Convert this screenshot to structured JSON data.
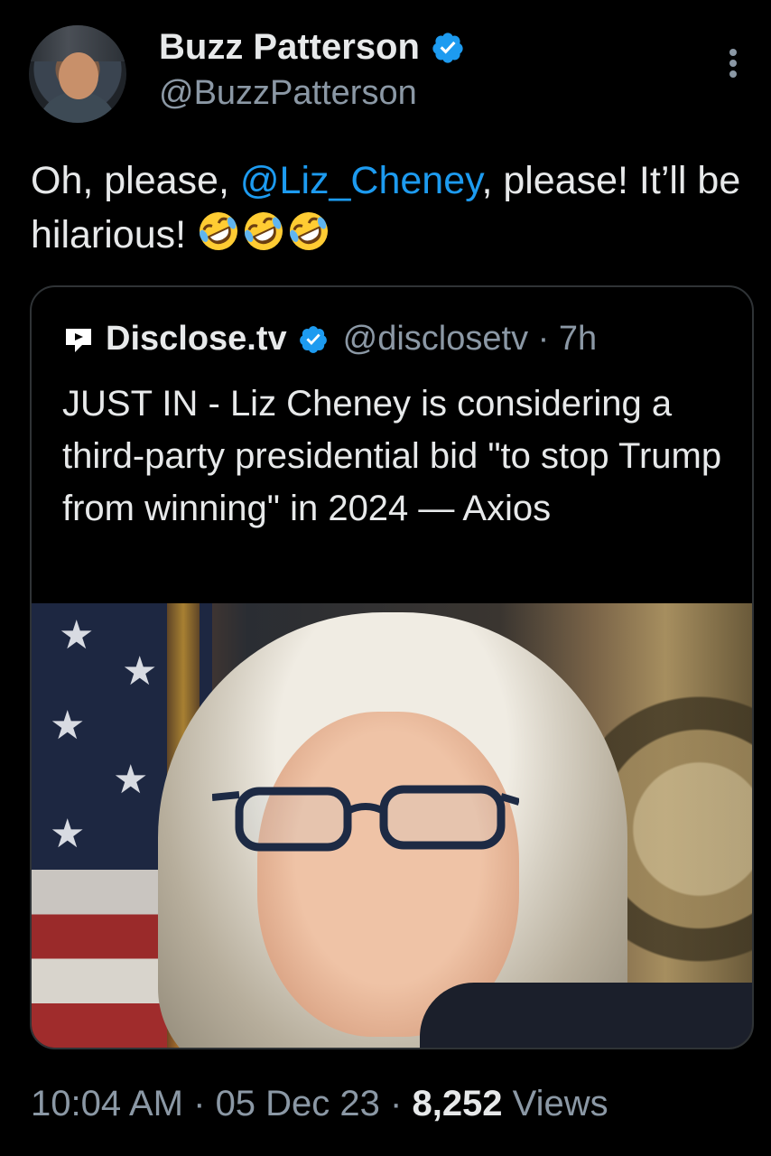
{
  "author": {
    "name": "Buzz Patterson",
    "handle": "@BuzzPatterson",
    "verified": true,
    "avatar_icon": "profile-photo"
  },
  "tweet": {
    "text_before": "Oh, please, ",
    "mention": "@Liz_Cheney",
    "text_after": ", please! It’ll be hilarious! ",
    "emojis": [
      "rolling-on-floor-laughing",
      "rolling-on-floor-laughing",
      "rolling-on-floor-laughing"
    ]
  },
  "quote": {
    "name": "Disclose.tv",
    "handle": "@disclosetv",
    "separator": "·",
    "time": "7h",
    "verified": true,
    "text": "JUST IN - Liz Cheney is considering a third-party presidential bid \"to stop Trump from winning\" in 2024 — Axios"
  },
  "footer": {
    "time": "10:04 AM",
    "sep1": " · ",
    "date": "05 Dec 23",
    "sep2": " · ",
    "views_count": "8,252",
    "views_label": " Views"
  },
  "colors": {
    "background": "#000000",
    "text": "#e7e9ea",
    "muted": "#8b98a5",
    "link": "#1d9bf0",
    "border": "#2f3336"
  }
}
